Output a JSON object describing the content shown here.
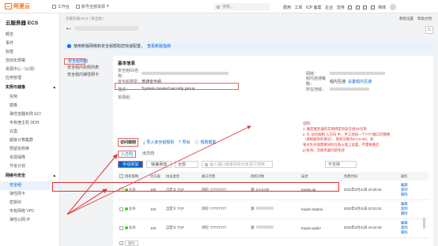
{
  "topbar": {
    "logo": "阿里云",
    "workbench": "工作台",
    "resource_group": "账号全部资源",
    "search_placeholder": "搜索...",
    "links": [
      "费用",
      "工单",
      "ICP 备案",
      "企业",
      "支持"
    ],
    "lang": "简体"
  },
  "sidebar": {
    "title": "云服务器 ECS",
    "items": [
      "概览",
      "事件",
      "标签",
      "自动化部署",
      "资源中心（公测）",
      "应用管理"
    ],
    "group1": "实例与镜像",
    "group1_items": [
      "实例",
      "镜像",
      "弹性容器实例 ECI",
      "专有宿主机 DDH",
      "云盒",
      "超级计算集群",
      "预留实例券",
      "资源保障",
      "节省计划"
    ],
    "group2": "网络与安全",
    "group2_items": [
      "安全组",
      "弹性网卡",
      "密钥对",
      "专有网络 VPC",
      "弹性公网 IP"
    ]
  },
  "main": {
    "breadcrumb": "云服务器 ECS / 安全组 / ",
    "toplinks": [
      "教程设置",
      "帮助文档"
    ],
    "refresh": "C",
    "banner_text": "使用新版网络和安全组帮助您快速配置，",
    "banner_link": "查看新版指南",
    "sublinks": [
      "安全组规则",
      "安全组内实例列表",
      "安全组内弹性网卡"
    ],
    "section": "基本信息",
    "info": {
      "id_label": "安全组ID/名称：",
      "type_label": "安全组类型：",
      "type_value": "普通安全组",
      "desc_label": "描述：",
      "desc_value": "System created security group",
      "group_label": "资源组：",
      "net_label": "网络：",
      "net_type_label": "组内连通策略：",
      "net_type_value": "组内互通",
      "net_type_link": "设置组内互通",
      "region_label": "所在地域："
    },
    "annotation": {
      "title": "说明：",
      "lines": [
        "1. 确定服务器的实例绑定的安全组ID/名称",
        "2. 在 访问规则 入方向 中，手工添加一个7777端口的策略",
        "   （请根据你的情况），授权对象为0.0.0.0/0，如",
        "   果对外开放需要同时在防火墙上设置，不需要重启",
        "   pc生效，云服务器内部生效"
      ]
    },
    "rule_tab": "访问规则",
    "rule_actions": [
      "导入安全组规则",
      "导出",
      "规则帮助"
    ],
    "inout": [
      "入方向",
      "出方向"
    ],
    "add_button": "手动添加",
    "quick_add": "快速添加",
    "filter_select": "全部",
    "filter_placeholder": "输入端口或者授权对象进行搜索",
    "filter_select2": "不支持",
    "table": {
      "headers": [
        "授权策略",
        "优先级",
        "协议类型",
        "端口范围",
        "授权对象",
        "描述",
        "创建时间",
        "操作"
      ],
      "rows": [
        {
          "policy": "允许",
          "priority": "100",
          "protocol": "自定义 TCP",
          "port": "目的: 7777/7777",
          "source": "源: 0.0.0.0/0",
          "desc": "Kepler.ad",
          "time": "2022年5月31日 20:29:18",
          "ops": [
            "编辑",
            "复制",
            "删除"
          ]
        },
        {
          "policy": "允许",
          "priority": "100",
          "protocol": "自定义 TCP",
          "port": "目的: 7777/7777",
          "source": "源: ",
          "desc": "Kepler.Satanic",
          "time": "2022年5月31日 20:23:22",
          "ops": [
            "编辑",
            "复制",
            "删除"
          ]
        },
        {
          "policy": "允许",
          "priority": "100",
          "protocol": "自定义 TCP",
          "port": "目的: 7777/7777",
          "source": "源: ",
          "desc": "Kepler.spider",
          "time": "2022年5月31日 15:44:20",
          "ops": [
            "编辑",
            "复制",
            "删除"
          ]
        }
      ],
      "footer_button": "删除"
    }
  }
}
